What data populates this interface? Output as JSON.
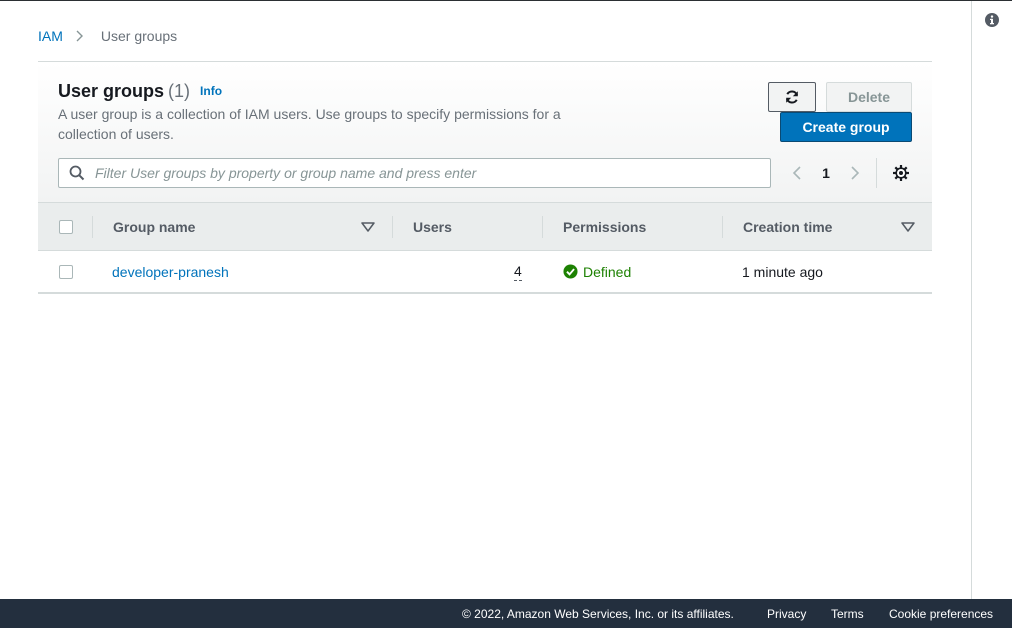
{
  "breadcrumb": {
    "root": "IAM",
    "current": "User groups"
  },
  "header": {
    "title": "User groups",
    "count": "(1)",
    "info": "Info",
    "description": "A user group is a collection of IAM users. Use groups to specify permissions for a collection of users."
  },
  "actions": {
    "delete": "Delete",
    "create": "Create group"
  },
  "search": {
    "placeholder": "Filter User groups by property or group name and press enter",
    "value": ""
  },
  "pagination": {
    "current_page": "1"
  },
  "table": {
    "columns": [
      "Group name",
      "Users",
      "Permissions",
      "Creation time"
    ],
    "rows": [
      {
        "group_name": "developer-pranesh",
        "users": "4",
        "permissions": "Defined",
        "creation_time": "1 minute ago"
      }
    ]
  },
  "footer": {
    "copyright": "© 2022, Amazon Web Services, Inc. or its affiliates.",
    "links": [
      "Privacy",
      "Terms",
      "Cookie preferences"
    ]
  },
  "colors": {
    "link": "#0073bb",
    "primary_button": "#0073bb",
    "success": "#1d8102",
    "footer_bg": "#232f3e"
  }
}
